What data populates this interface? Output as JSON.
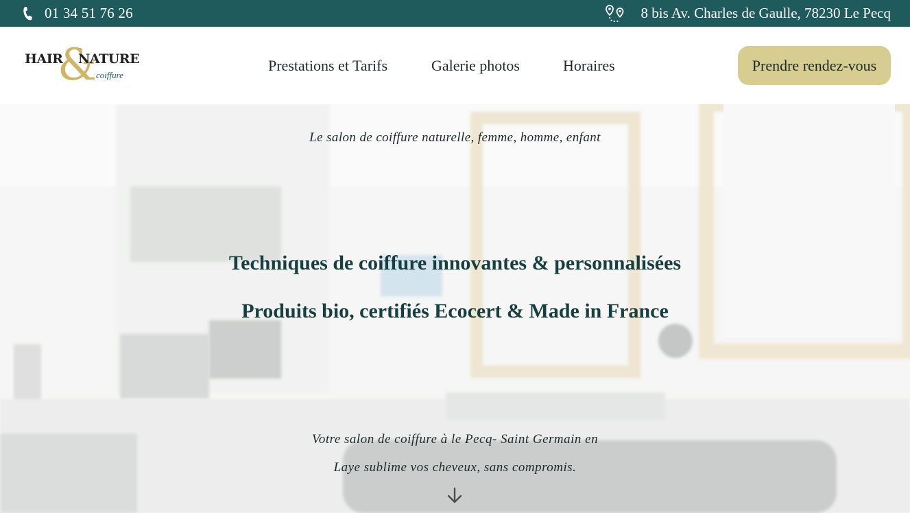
{
  "topbar": {
    "phone": "01 34 51 76 26",
    "phone_icon": "phone-icon",
    "address": "8 bis Av. Charles de Gaulle, 78230 Le Pecq",
    "address_icon": "map-pin-route-icon",
    "background": "#1f5a5c"
  },
  "logo": {
    "hair": "HAIR",
    "nature": "NATURE",
    "ampersand": "&",
    "coiffure": "coiffure"
  },
  "nav": {
    "items": [
      {
        "label": "Prestations et Tarifs"
      },
      {
        "label": "Galerie photos"
      },
      {
        "label": "Horaires"
      }
    ]
  },
  "cta": {
    "label": "Prendre rendez-vous",
    "color": "#d8cd90"
  },
  "hero": {
    "tagline": "Le salon de coiffure naturelle, femme, homme, enfant",
    "headline_1": "Techniques de coiffure innovantes & personnalisées",
    "headline_2": "Produits bio, certifiés Ecocert & Made in France",
    "description_line_1": "Votre salon de coiffure à le Pecq- Saint Germain en",
    "description_line_2": "Laye sublime vos cheveux, sans compromis.",
    "scroll_icon": "arrow-down-icon",
    "heading_color": "#173f3f"
  }
}
